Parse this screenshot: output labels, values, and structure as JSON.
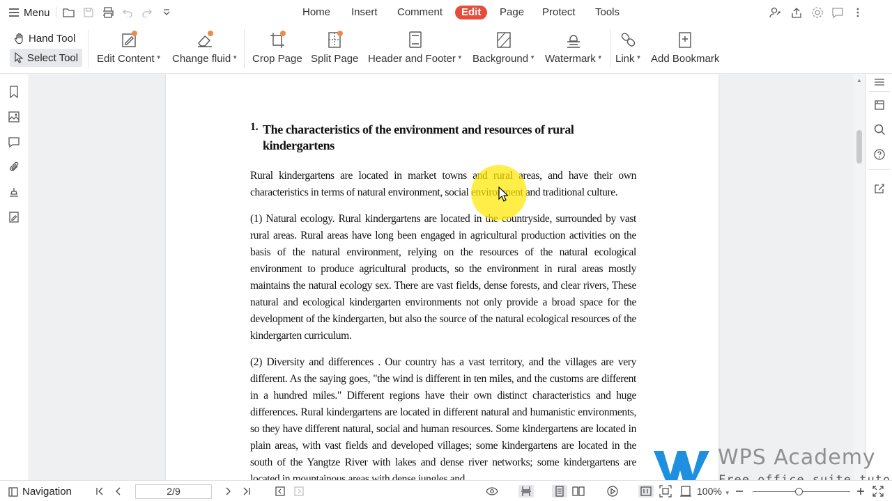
{
  "topbar": {
    "menu_label": "Menu",
    "tabs": [
      {
        "label": "Home"
      },
      {
        "label": "Insert"
      },
      {
        "label": "Comment"
      },
      {
        "label": "Edit",
        "active": true
      },
      {
        "label": "Page"
      },
      {
        "label": "Protect"
      },
      {
        "label": "Tools"
      }
    ],
    "accent_color": "#e74b3c"
  },
  "ribbon": {
    "hand_tool": "Hand Tool",
    "select_tool": "Select Tool",
    "items": [
      {
        "label": "Edit Content",
        "icon": "edit-content-icon",
        "dropdown": true
      },
      {
        "label": "Change fluid",
        "icon": "eraser-icon",
        "dropdown": true
      },
      {
        "label": "Crop Page",
        "icon": "crop-page-icon"
      },
      {
        "label": "Split Page",
        "icon": "split-page-icon"
      },
      {
        "label": "Header and Footer",
        "icon": "header-footer-icon",
        "dropdown": true
      },
      {
        "label": "Background",
        "icon": "background-icon",
        "dropdown": true
      },
      {
        "label": "Watermark",
        "icon": "watermark-icon",
        "dropdown": true
      },
      {
        "label": "Link",
        "icon": "link-icon",
        "dropdown": true
      },
      {
        "label": "Add Bookmark",
        "icon": "add-bookmark-icon"
      }
    ]
  },
  "document": {
    "heading_number": "1.",
    "heading_text": "The characteristics of the environment and resources of rural kindergartens",
    "paragraphs": [
      "Rural kindergartens are located in market towns and rural areas, and have their own characteristics in terms of natural environment, social environment and traditional culture.",
      "(1) Natural ecology. Rural kindergartens are located in the countryside, surrounded by vast rural areas. Rural areas have long been engaged in agricultural production activities on the basis of the natural environment, relying on the resources of the natural ecological environment to produce agricultural products, so the environment in rural areas mostly maintains the natural ecology sex. There are vast fields, dense forests, and clear rivers, These natural and ecological kindergarten environments not only provide a broad space for the development of the kindergarten, but also the source of the natural ecological resources of the kindergarten curriculum.",
      "(2) Diversity and differences . Our country has a vast territory, and the villages are very different. As the saying goes, \"the wind is different in ten miles, and the customs are different in a hundred miles.\" Different regions have their own distinct characteristics and huge differences. Rural kindergartens are located in different natural and humanistic environments, so they have different natural, social and human resources. Some kindergartens are located in plain areas, with vast fields and developed villages; some kindergartens are located in the south of the Yangtze River with lakes and dense river networks; some kindergartens are located in mountainous areas with dense jungles and"
    ]
  },
  "watermark": {
    "title": "WPS Academy",
    "subtitle": "Free office suite tutorials"
  },
  "statusbar": {
    "navigation_label": "Navigation",
    "page_indicator": "2/9",
    "zoom": "100%",
    "zoom_fraction": 0.48
  }
}
